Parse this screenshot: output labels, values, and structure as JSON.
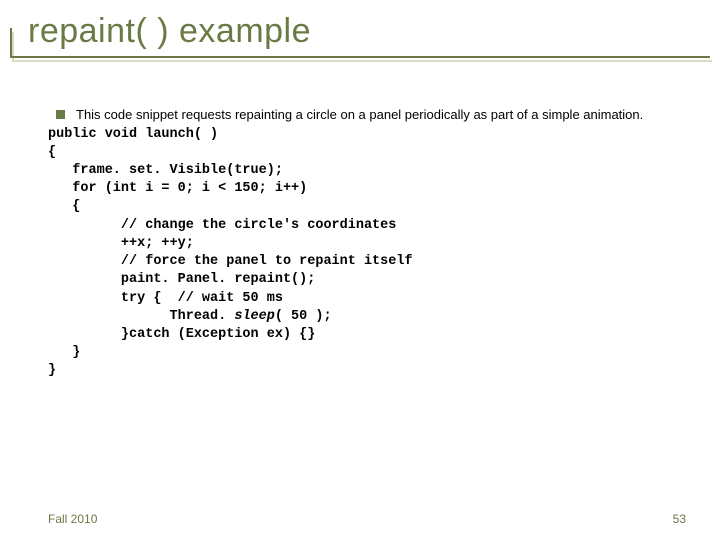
{
  "title": "repaint( ) example",
  "bullet_text": "This code snippet requests repainting a circle on a panel periodically as part of a simple animation.",
  "code": {
    "l1": "public void launch( )",
    "l2": "{",
    "l3": "   frame. set. Visible(true);",
    "l4": "   for (int i = 0; i < 150; i++)",
    "l5": "   {",
    "l6": "         // change the circle's coordinates",
    "l7": "         ++x; ++y;",
    "l8": "         // force the panel to repaint itself",
    "l9": "         paint. Panel. repaint();",
    "l10a": "         try {  ",
    "l10b": "// wait 50 ms",
    "l11a": "               Thread. ",
    "l11b": "sleep",
    "l11c": "( 50 );",
    "l12": "         }catch (Exception ex) {}",
    "l13": "   }",
    "l14": "}"
  },
  "footer": {
    "left": "Fall 2010",
    "right": "53"
  }
}
